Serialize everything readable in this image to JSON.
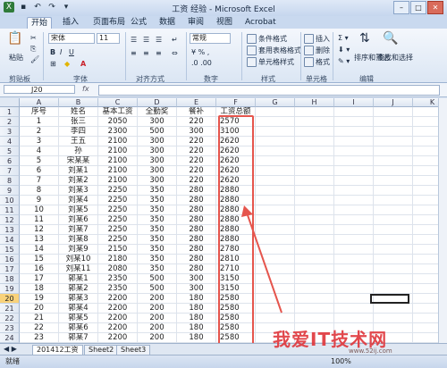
{
  "window": {
    "title": "工资 经验 - Microsoft Excel"
  },
  "ribbon_tabs": [
    "开始",
    "插入",
    "页面布局",
    "公式",
    "数据",
    "审阅",
    "视图",
    "Acrobat"
  ],
  "ribbon": {
    "paste": "粘贴",
    "font_name": "宋体",
    "font_size": "11",
    "number_format": "常规",
    "cond_format": "条件格式",
    "table_format": "套用表格格式",
    "cell_style": "单元格样式",
    "insert": "插入",
    "delete": "删除",
    "format": "格式",
    "sort_filter": "排序和筛选",
    "find_select": "查找和选择",
    "groups": [
      "剪贴板",
      "字体",
      "对齐方式",
      "数字",
      "样式",
      "单元格",
      "编辑"
    ]
  },
  "namebox": "J20",
  "fx_label": "fx",
  "columns": [
    "A",
    "B",
    "C",
    "D",
    "E",
    "F",
    "G",
    "H",
    "I",
    "J",
    "K"
  ],
  "rows": [
    [
      "序号",
      "姓名",
      "基本工资",
      "全勤奖",
      "餐补",
      "工资总额"
    ],
    [
      "1",
      "张三",
      "2050",
      "300",
      "220",
      "2570"
    ],
    [
      "2",
      "李四",
      "2300",
      "500",
      "300",
      "3100"
    ],
    [
      "3",
      "王五",
      "2100",
      "300",
      "220",
      "2620"
    ],
    [
      "4",
      "孙",
      "2100",
      "300",
      "220",
      "2620"
    ],
    [
      "5",
      "宋某某",
      "2100",
      "300",
      "220",
      "2620"
    ],
    [
      "6",
      "刘某1",
      "2100",
      "300",
      "220",
      "2620"
    ],
    [
      "7",
      "刘某2",
      "2100",
      "300",
      "220",
      "2620"
    ],
    [
      "8",
      "刘某3",
      "2250",
      "350",
      "280",
      "2880"
    ],
    [
      "9",
      "刘某4",
      "2250",
      "350",
      "280",
      "2880"
    ],
    [
      "10",
      "刘某5",
      "2250",
      "350",
      "280",
      "2880"
    ],
    [
      "11",
      "刘某6",
      "2250",
      "350",
      "280",
      "2880"
    ],
    [
      "12",
      "刘某7",
      "2250",
      "350",
      "280",
      "2880"
    ],
    [
      "13",
      "刘某8",
      "2250",
      "350",
      "280",
      "2880"
    ],
    [
      "14",
      "刘某9",
      "2150",
      "350",
      "280",
      "2780"
    ],
    [
      "15",
      "刘某10",
      "2180",
      "350",
      "280",
      "2810"
    ],
    [
      "16",
      "刘某11",
      "2080",
      "350",
      "280",
      "2710"
    ],
    [
      "17",
      "郭某1",
      "2350",
      "500",
      "300",
      "3150"
    ],
    [
      "18",
      "郭某2",
      "2350",
      "500",
      "300",
      "3150"
    ],
    [
      "19",
      "郭某3",
      "2200",
      "200",
      "180",
      "2580"
    ],
    [
      "20",
      "郭某4",
      "2200",
      "200",
      "180",
      "2580"
    ],
    [
      "21",
      "郭某5",
      "2200",
      "200",
      "180",
      "2580"
    ],
    [
      "22",
      "郭某6",
      "2200",
      "200",
      "180",
      "2580"
    ],
    [
      "23",
      "郭某7",
      "2200",
      "200",
      "180",
      "2580"
    ]
  ],
  "sheets": [
    "201412工资",
    "Sheet2",
    "Sheet3"
  ],
  "status": {
    "ready": "就绪",
    "zoom": "100%"
  },
  "watermark": "我爱IT技术网",
  "watermark_site": "www.52ij.com"
}
